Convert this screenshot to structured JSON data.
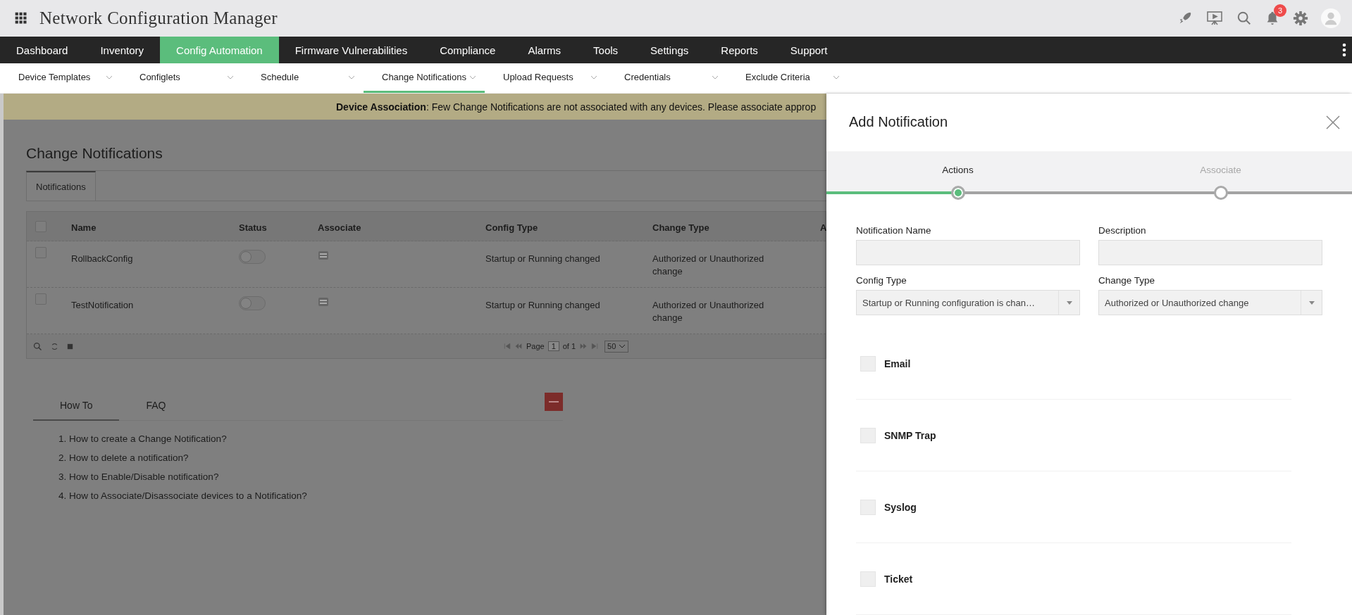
{
  "app": {
    "title": "Network Configuration Manager",
    "notification_count": "3"
  },
  "nav": [
    {
      "label": "Dashboard",
      "selected": false
    },
    {
      "label": "Inventory",
      "selected": false
    },
    {
      "label": "Config Automation",
      "selected": true
    },
    {
      "label": "Firmware Vulnerabilities",
      "selected": false
    },
    {
      "label": "Compliance",
      "selected": false
    },
    {
      "label": "Alarms",
      "selected": false
    },
    {
      "label": "Tools",
      "selected": false
    },
    {
      "label": "Settings",
      "selected": false
    },
    {
      "label": "Reports",
      "selected": false
    },
    {
      "label": "Support",
      "selected": false
    }
  ],
  "subnav": [
    {
      "label": "Device Templates",
      "selected": false
    },
    {
      "label": "Configlets",
      "selected": false
    },
    {
      "label": "Schedule",
      "selected": false
    },
    {
      "label": "Change Notifications",
      "selected": true
    },
    {
      "label": "Upload Requests",
      "selected": false
    },
    {
      "label": "Credentials",
      "selected": false
    },
    {
      "label": "Exclude Criteria",
      "selected": false
    }
  ],
  "banner": {
    "text": "**Device Association**: Few Change Notifications are not associated with any devices. Please associate approp"
  },
  "page": {
    "title": "Change Notifications",
    "tabs": [
      {
        "label": "Notifications",
        "selected": true
      }
    ],
    "table": {
      "checked": false,
      "columns": [
        "Name",
        "Status",
        "Associate",
        "Config Type",
        "Change Type",
        "A"
      ],
      "rows": [
        {
          "checked": false,
          "name": "RollbackConfig",
          "on": false,
          "config_type": "Startup or Running changed",
          "change_type": "Authorized or Unauthorized change"
        },
        {
          "checked": false,
          "name": "TestNotification",
          "on": false,
          "config_type": "Startup or Running changed",
          "change_type": "Authorized or Unauthorized change"
        }
      ]
    },
    "pager": {
      "page_label": "Page",
      "page": "1",
      "of": "of 1",
      "page_size": "50"
    }
  },
  "help": {
    "tabs": [
      {
        "label": "How To",
        "selected": true
      },
      {
        "label": "FAQ",
        "selected": false
      }
    ],
    "items": [
      "1. How to create a Change Notification?",
      "2. How to delete a notification?",
      "3. How to Enable/Disable notification?",
      "4. How to Associate/Disassociate devices to a Notification?"
    ]
  },
  "drawer": {
    "title": "Add Notification",
    "steps": [
      {
        "label": "Actions",
        "selected": true
      },
      {
        "label": "Associate",
        "selected": false
      }
    ],
    "fields": [
      {
        "kind": "input",
        "label": "Notification Name"
      },
      {
        "kind": "input",
        "label": "Description"
      },
      {
        "kind": "select",
        "label": "Config Type",
        "value": "Startup or Running configuration is chan…"
      },
      {
        "kind": "select",
        "label": "Change Type",
        "value": "Authorized or Unauthorized change"
      }
    ],
    "options": [
      {
        "label": "Email",
        "checked": false
      },
      {
        "label": "SNMP Trap",
        "checked": false
      },
      {
        "label": "Syslog",
        "checked": false
      },
      {
        "label": "Ticket",
        "checked": false
      }
    ]
  }
}
